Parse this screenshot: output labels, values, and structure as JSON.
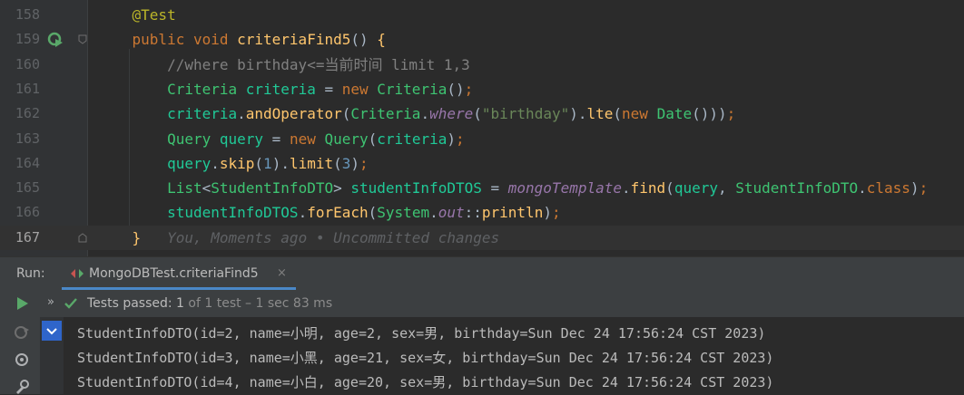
{
  "editor": {
    "lines": [
      {
        "num": "158",
        "tokens": [
          [
            "an",
            "    @Test"
          ]
        ]
      },
      {
        "num": "159",
        "tokens": [
          [
            "kw",
            "    public void "
          ],
          [
            "fn",
            "criteriaFind5"
          ],
          [
            "pl",
            "() "
          ],
          [
            "fn",
            "{"
          ]
        ]
      },
      {
        "num": "160",
        "tokens": [
          [
            "cm",
            "        //where birthday<=当前时间 limit 1,3"
          ]
        ]
      },
      {
        "num": "161",
        "tokens": [
          [
            "tp",
            "        Criteria "
          ],
          [
            "vr",
            "criteria"
          ],
          [
            "pl",
            " = "
          ],
          [
            "kw",
            "new "
          ],
          [
            "tp",
            "Criteria"
          ],
          [
            "pl",
            "()"
          ],
          [
            "kw",
            ";"
          ]
        ]
      },
      {
        "num": "162",
        "tokens": [
          [
            "vr",
            "        criteria"
          ],
          [
            "pl",
            "."
          ],
          [
            "fn",
            "andOperator"
          ],
          [
            "pl",
            "("
          ],
          [
            "tp",
            "Criteria"
          ],
          [
            "pl",
            "."
          ],
          [
            "it",
            "where"
          ],
          [
            "pl",
            "("
          ],
          [
            "st",
            "\"birthday\""
          ],
          [
            "pl",
            ")."
          ],
          [
            "fn",
            "lte"
          ],
          [
            "pl",
            "("
          ],
          [
            "kw",
            "new "
          ],
          [
            "tp",
            "Date"
          ],
          [
            "pl",
            "()))"
          ],
          [
            "kw",
            ";"
          ]
        ]
      },
      {
        "num": "163",
        "tokens": [
          [
            "tp",
            "        Query "
          ],
          [
            "vr",
            "query"
          ],
          [
            "pl",
            " = "
          ],
          [
            "kw",
            "new "
          ],
          [
            "tp",
            "Query"
          ],
          [
            "pl",
            "("
          ],
          [
            "vr",
            "criteria"
          ],
          [
            "pl",
            ")"
          ],
          [
            "kw",
            ";"
          ]
        ]
      },
      {
        "num": "164",
        "tokens": [
          [
            "vr",
            "        query"
          ],
          [
            "pl",
            "."
          ],
          [
            "fn",
            "skip"
          ],
          [
            "pl",
            "("
          ],
          [
            "nm",
            "1"
          ],
          [
            "pl",
            ")."
          ],
          [
            "fn",
            "limit"
          ],
          [
            "pl",
            "("
          ],
          [
            "nm",
            "3"
          ],
          [
            "pl",
            ")"
          ],
          [
            "kw",
            ";"
          ]
        ]
      },
      {
        "num": "165",
        "tokens": [
          [
            "tp",
            "        List"
          ],
          [
            "pl",
            "<"
          ],
          [
            "tp",
            "StudentInfoDTO"
          ],
          [
            "pl",
            "> "
          ],
          [
            "vr",
            "studentInfoDTOS"
          ],
          [
            "pl",
            " = "
          ],
          [
            "fd",
            "mongoTemplate"
          ],
          [
            "pl",
            "."
          ],
          [
            "fn",
            "find"
          ],
          [
            "pl",
            "("
          ],
          [
            "vr",
            "query"
          ],
          [
            "pl",
            ", "
          ],
          [
            "tp",
            "StudentInfoDTO"
          ],
          [
            "pl",
            "."
          ],
          [
            "kw",
            "class"
          ],
          [
            "pl",
            ")"
          ],
          [
            "kw",
            ";"
          ]
        ]
      },
      {
        "num": "166",
        "tokens": [
          [
            "vr",
            "        studentInfoDTOS"
          ],
          [
            "pl",
            "."
          ],
          [
            "fn",
            "forEach"
          ],
          [
            "pl",
            "("
          ],
          [
            "tp",
            "System"
          ],
          [
            "pl",
            "."
          ],
          [
            "it",
            "out"
          ],
          [
            "pl",
            "::"
          ],
          [
            "fn",
            "println"
          ],
          [
            "pl",
            ")"
          ],
          [
            "kw",
            ";"
          ]
        ]
      },
      {
        "num": "167",
        "tokens": [
          [
            "fn",
            "    }"
          ],
          [
            "blame",
            "   You, Moments ago • Uncommitted changes"
          ]
        ]
      }
    ]
  },
  "run": {
    "label": "Run:",
    "tab_label": "MongoDBTest.criteriaFind5",
    "close_glyph": "×",
    "status_prefix": "Tests passed: ",
    "status_count": "1",
    "status_suffix": " of 1 test – 1 sec 83 ms",
    "expand_glyph": "»"
  },
  "console": {
    "lines": [
      "StudentInfoDTO(id=2, name=小明, age=2, sex=男, birthday=Sun Dec 24 17:56:24 CST 2023)",
      "StudentInfoDTO(id=3, name=小黑, age=21, sex=女, birthday=Sun Dec 24 17:56:24 CST 2023)",
      "StudentInfoDTO(id=4, name=小白, age=20, sex=男, birthday=Sun Dec 24 17:56:24 CST 2023)"
    ]
  },
  "colors": {
    "keyword": "#cc7832",
    "function": "#ffc66d",
    "comment": "#808080",
    "string": "#6a8759",
    "number": "#6897bb",
    "accent": "#4a88c7",
    "pass": "#59a869"
  }
}
